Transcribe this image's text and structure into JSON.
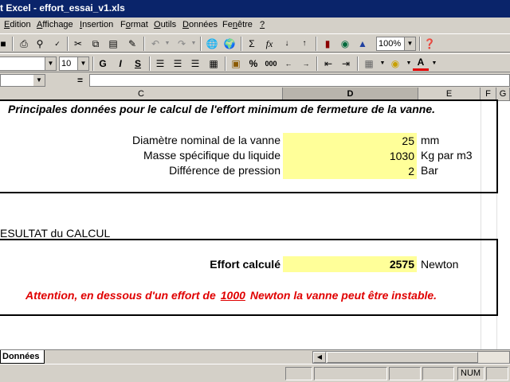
{
  "window": {
    "title": "t Excel - effort_essai_v1.xls"
  },
  "menu": {
    "items": [
      {
        "pre": "",
        "key": "E",
        "post": "dition"
      },
      {
        "pre": "",
        "key": "A",
        "post": "ffichage"
      },
      {
        "pre": "",
        "key": "I",
        "post": "nsertion"
      },
      {
        "pre": "F",
        "key": "o",
        "post": "rmat"
      },
      {
        "pre": "",
        "key": "O",
        "post": "utils"
      },
      {
        "pre": "",
        "key": "D",
        "post": "onnées"
      },
      {
        "pre": "Fe",
        "key": "n",
        "post": "être"
      },
      {
        "pre": "",
        "key": "?",
        "post": ""
      }
    ]
  },
  "toolbar": {
    "zoom": "100%",
    "font_size": "10",
    "bold": "G",
    "italic": "I",
    "underline": "S",
    "percent": "%",
    "thousands": "000",
    "sum": "Σ",
    "fx": "fx"
  },
  "formula_bar": {
    "equals": "="
  },
  "columns": [
    "C",
    "D",
    "E",
    "F",
    "G"
  ],
  "sheet": {
    "heading": "Principales données pour le calcul de l'effort minimum de fermeture de la vanne.",
    "inputs": [
      {
        "label": "Diamètre nominal de la vanne",
        "value": "25",
        "unit": "mm"
      },
      {
        "label": "Masse spécifique du liquide",
        "value": "1030",
        "unit": "Kg par m3"
      },
      {
        "label": "Différence de pression",
        "value": "2",
        "unit": "Bar"
      }
    ],
    "result_section": "ESULTAT du CALCUL",
    "result": {
      "label": "Effort calculé",
      "value": "2575",
      "unit": "Newton"
    },
    "warning": {
      "before": "Attention, en dessous d'un effort de",
      "value": "1000",
      "after": "Newton la vanne peut être instable."
    }
  },
  "tabs": {
    "active": "Données"
  },
  "status": {
    "num": "NUM"
  },
  "colors": {
    "input_fill": "#ffff99",
    "warning": "#e00000",
    "titlebar": "#0a246a"
  }
}
